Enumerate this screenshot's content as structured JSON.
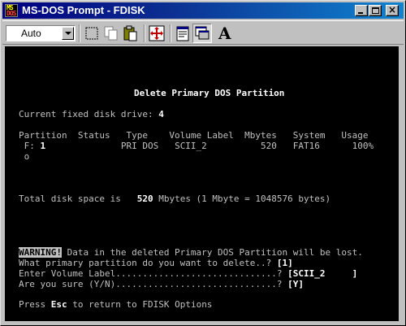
{
  "window": {
    "title": "MS-DOS Prompt - FDISK",
    "icon_label_top": "MS",
    "icon_label_bottom": "DOS"
  },
  "toolbar": {
    "font_combo_value": "Auto",
    "buttons": [
      "mark-icon",
      "copy-icon",
      "paste-icon",
      "fullscreen-icon",
      "properties-icon",
      "background-icon",
      "font-icon"
    ],
    "font_button_label": "A"
  },
  "screen": {
    "heading": "Delete Primary DOS Partition",
    "drive_label": "Current fixed disk drive: ",
    "drive_value": "4",
    "table_header": "Partition  Status   Type    Volume Label  Mbytes   System   Usage",
    "row_part1": " F: ",
    "row_num": "1",
    "row_rest": "              PRI DOS   SCII_2          520   FAT16      100%",
    "row_wrap": " o",
    "total_pre": "Total disk space is   ",
    "total_value": "520",
    "total_post": " Mbytes (1 Mbyte = 1048576 bytes)",
    "warning_label": "WARNING!",
    "warning_text": " Data in the deleted Primary DOS Partition will be lost.",
    "q1_text": "What primary partition do you want to delete..? ",
    "q1_value": "[1]",
    "q2_text": "Enter Volume Label..............................? ",
    "q2_value": "[SCII_2     ]",
    "q3_text": "Are you sure (Y/N)..............................? ",
    "q3_value": "[Y]",
    "footer_pre": "Press ",
    "footer_key": "Esc",
    "footer_post": " to return to FDISK Options"
  },
  "colors": {
    "title_start": "#000080",
    "title_end": "#1084d0",
    "terminal_bg": "#000000",
    "terminal_fg": "#c0c0c0",
    "terminal_highlight": "#ffffff"
  }
}
